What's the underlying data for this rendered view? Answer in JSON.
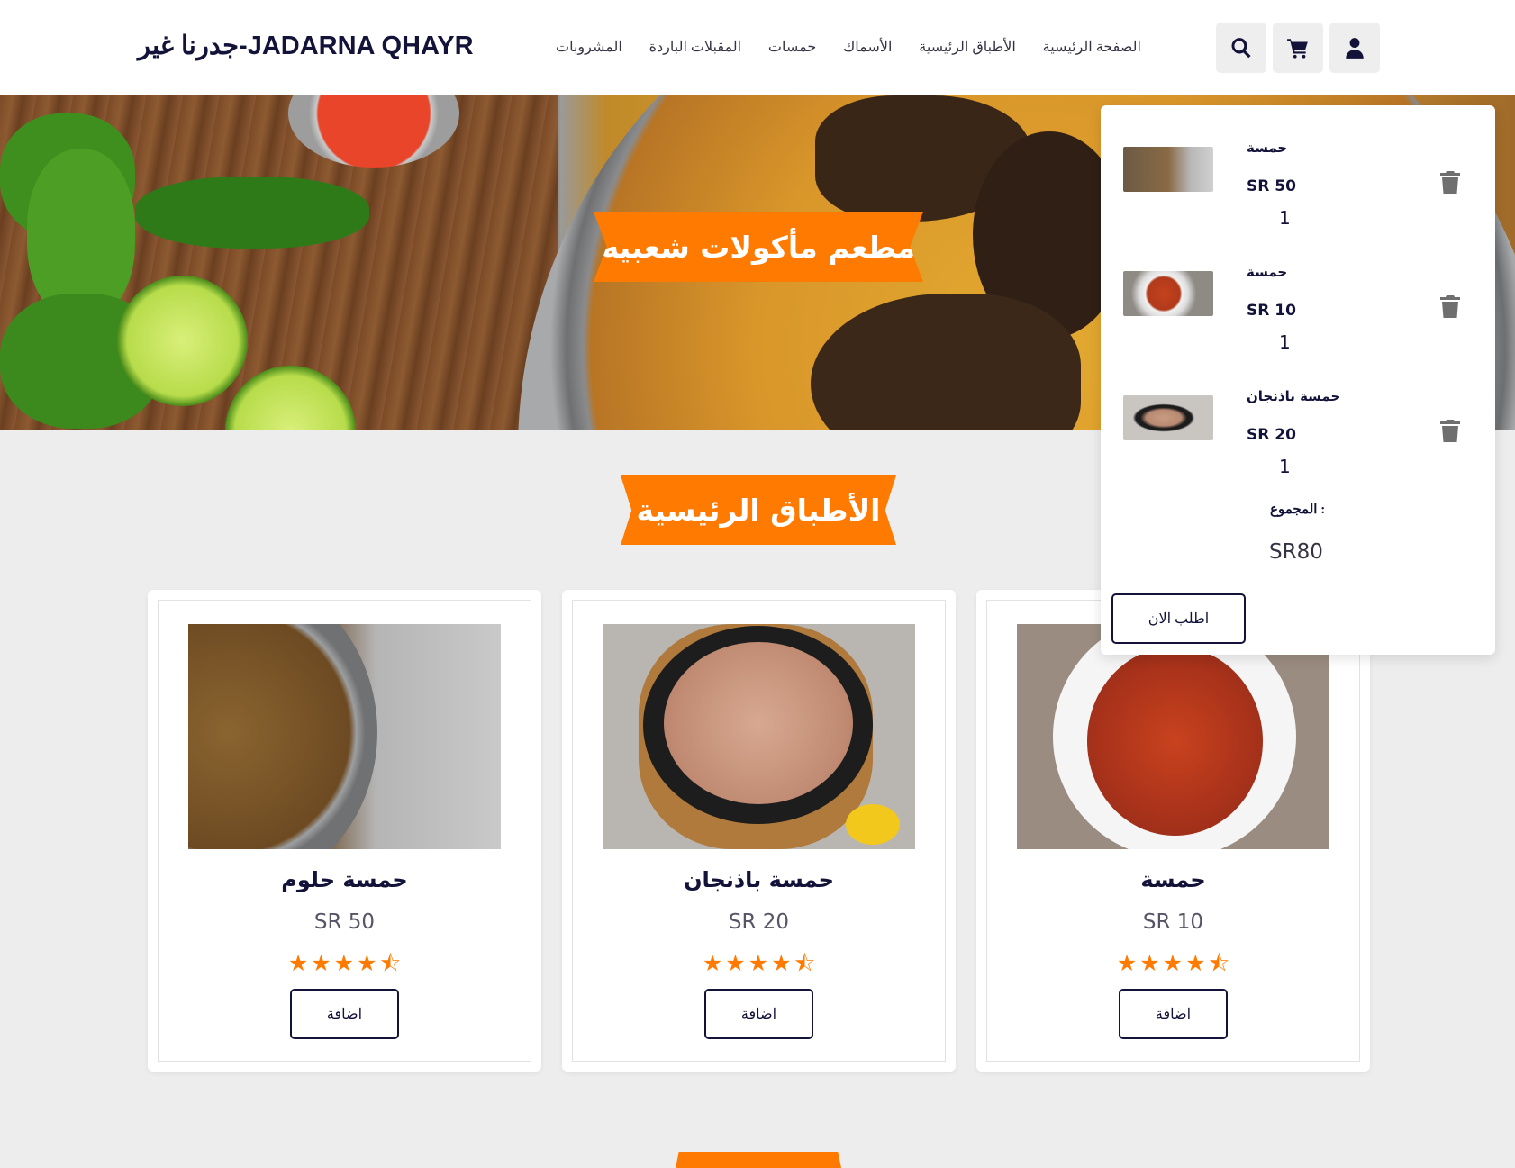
{
  "header": {
    "logo": "جدرنا غير-JADARNA QHAYR",
    "nav": [
      "الصفحة الرئيسية",
      "الأطباق الرئيسية",
      "الأسماك",
      "حمسات",
      "المقبلات الباردة",
      "المشروبات"
    ],
    "icons": [
      "user-icon",
      "cart-icon",
      "search-icon"
    ]
  },
  "hero": {
    "title": "مطعم مأكولات شعبيه"
  },
  "section": {
    "title": "الأطباق الرئيسية"
  },
  "products": [
    {
      "name": "حمسة حلوم",
      "price": "SR 50",
      "rating": 4.5,
      "add_label": "اضافة"
    },
    {
      "name": "حمسة باذنجان",
      "price": "SR 20",
      "rating": 4.5,
      "add_label": "اضافة"
    },
    {
      "name": "حمسة",
      "price": "SR 10",
      "rating": 4.5,
      "add_label": "اضافة"
    }
  ],
  "cart": {
    "items": [
      {
        "title": "حمسة",
        "price": "SR 50",
        "qty": "1"
      },
      {
        "title": "حمسة",
        "price": "SR 10",
        "qty": "1"
      },
      {
        "title": "حمسة باذنجان",
        "price": "SR 20",
        "qty": "1"
      }
    ],
    "total_label": "المجموع :",
    "total_value": "SR80",
    "order_label": "اطلب الان"
  },
  "colors": {
    "accent": "#ff7a00",
    "primary": "#13133a",
    "background": "#ededed"
  }
}
